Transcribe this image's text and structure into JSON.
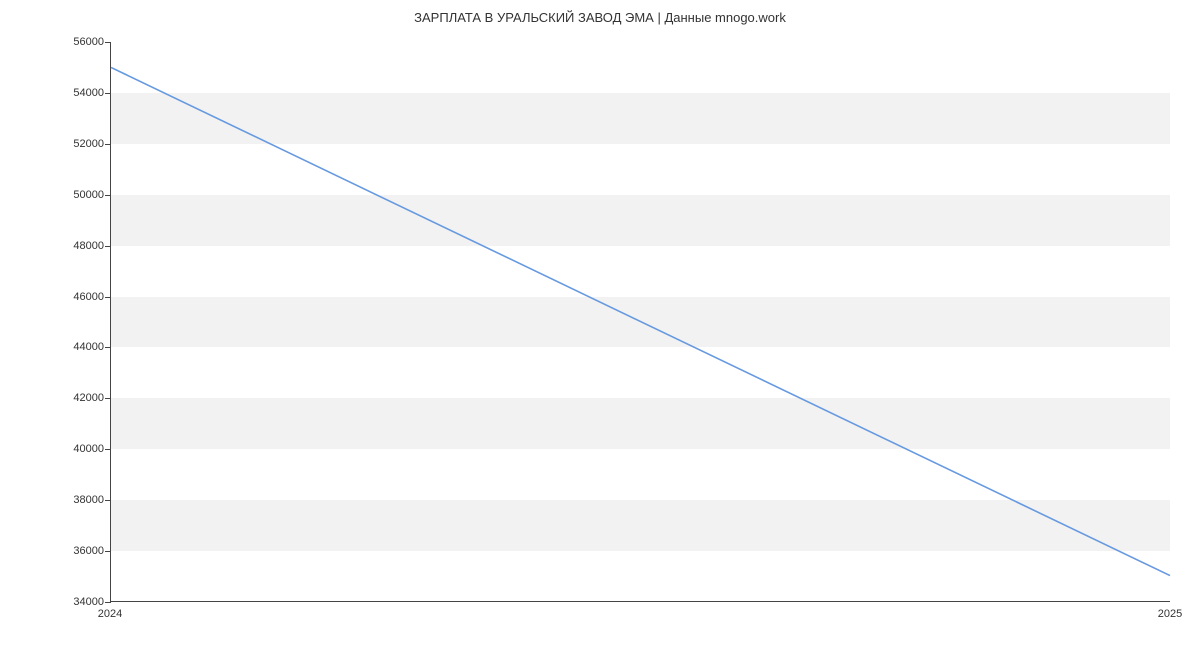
{
  "chart_data": {
    "type": "line",
    "title": "ЗАРПЛАТА В  УРАЛЬСКИЙ ЗАВОД ЭМА | Данные mnogo.work",
    "xlabel": "",
    "ylabel": "",
    "x_categories": [
      "2024",
      "2025"
    ],
    "series": [
      {
        "name": "salary",
        "color": "#6699e0",
        "values": [
          55000,
          35000
        ]
      }
    ],
    "ylim": [
      34000,
      56000
    ],
    "yticks": [
      34000,
      36000,
      38000,
      40000,
      42000,
      44000,
      46000,
      48000,
      50000,
      52000,
      54000,
      56000
    ],
    "band_color": "#f2f2f2"
  }
}
